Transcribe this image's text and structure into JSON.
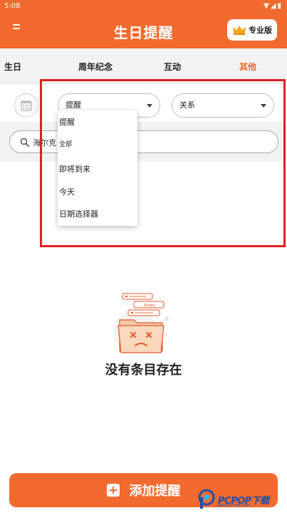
{
  "status_bar": {
    "time": "5:08"
  },
  "app_bar": {
    "title": "生日提醒",
    "pro_label": "专业版"
  },
  "tabs": [
    {
      "label": "生日",
      "active": false
    },
    {
      "label": "周年纪念",
      "active": false
    },
    {
      "label": "互动",
      "active": false
    },
    {
      "label": "其他",
      "active": true
    }
  ],
  "filters": {
    "reminder_select": "提醒",
    "relation_select": "关系"
  },
  "search": {
    "value": "海尔克"
  },
  "dropdown": {
    "options": [
      "提醒",
      "全部",
      "即将到来",
      "今天",
      "日期选择器"
    ]
  },
  "empty_state": {
    "message": "没有条目存在",
    "card_text": "Empty"
  },
  "add_button": {
    "label": "添加提醒"
  },
  "watermark": {
    "text": "PCPOP下载",
    "subtext": "WWW.PCPOP.COM"
  },
  "colors": {
    "accent": "#f26a2e",
    "highlight": "#e02020",
    "tab_bg": "#f2f2f2"
  }
}
